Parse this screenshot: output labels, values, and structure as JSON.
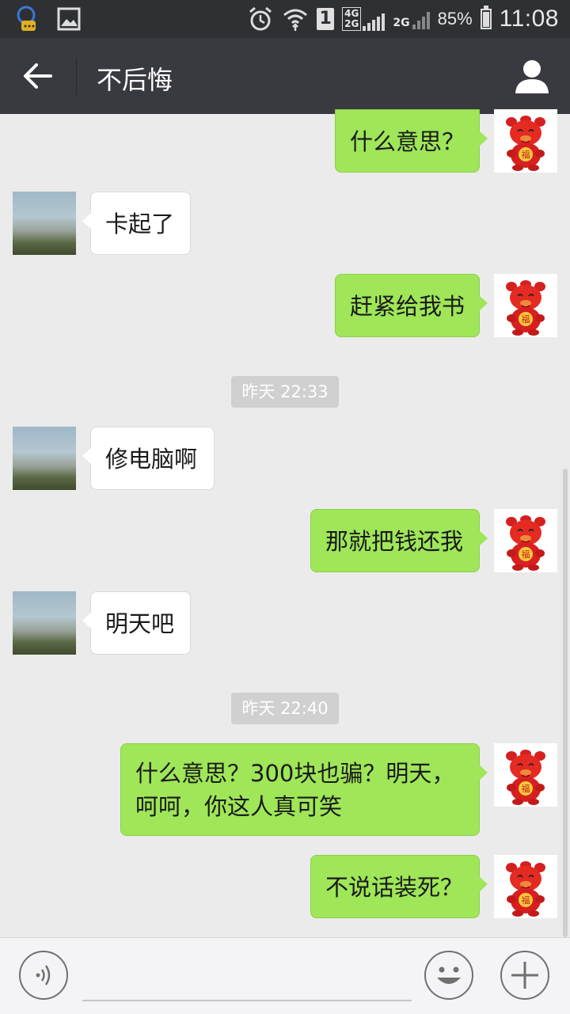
{
  "status_bar": {
    "battery": "85%",
    "time": "11:08",
    "network_top": "4G",
    "network_bottom": "2G",
    "network2": "2G",
    "sim": "1",
    "icons": [
      "notification-chat-icon",
      "image-icon",
      "alarm-icon",
      "wifi-icon"
    ]
  },
  "header": {
    "title": "不后悔",
    "back_icon": "arrow-left-icon",
    "profile_icon": "person-icon"
  },
  "messages": [
    {
      "side": "out",
      "text": "什么意思？"
    },
    {
      "side": "in",
      "text": "卡起了"
    },
    {
      "side": "out",
      "text": "赶紧给我书"
    },
    {
      "side": "in",
      "text": "修电脑啊"
    },
    {
      "side": "out",
      "text": "那就把钱还我"
    },
    {
      "side": "in",
      "text": "明天吧"
    },
    {
      "side": "out",
      "text": "什么意思？300块也骗？明天，呵呵，你这人真可笑"
    },
    {
      "side": "out",
      "text": "不说话装死？"
    }
  ],
  "timestamps": [
    "昨天 22:33",
    "昨天 22:40"
  ],
  "message_lines": [
    "什么意思？300块也骗？明天，",
    "呵呵，你这人真可笑"
  ],
  "avatar_badge": "福",
  "input_bar": {
    "voice_icon": "voice-icon",
    "emoji_icon": "emoji-icon",
    "plus_icon": "plus-icon"
  },
  "colors": {
    "out_bubble": "#9fe658",
    "in_bubble": "#ffffff",
    "title_bar": "#393a3f",
    "background": "#ebebeb"
  }
}
